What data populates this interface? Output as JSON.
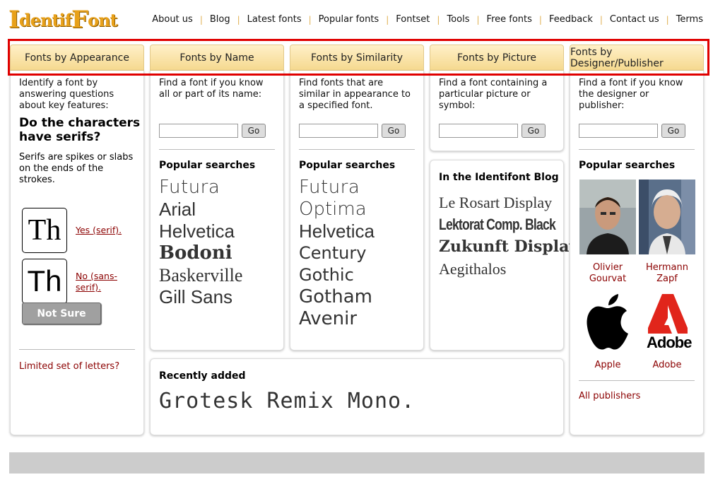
{
  "logo": {
    "part1": "I",
    "part2": "dentif",
    "part3": "ont"
  },
  "topnav": [
    "About us",
    "Blog",
    "Latest fonts",
    "Popular fonts",
    "Fontset",
    "Tools",
    "Free fonts",
    "Feedback",
    "Contact us",
    "Terms"
  ],
  "tabs": [
    "Fonts by Appearance",
    "Fonts by Name",
    "Fonts by Similarity",
    "Fonts by Picture",
    "Fonts by Designer/Publisher"
  ],
  "appearance": {
    "desc": "Identify a font by answering questions about key features:",
    "question": "Do the characters have serifs?",
    "note": "Serifs are spikes or slabs on the ends of the strokes.",
    "sample": "Th",
    "yes_label": "Yes (serif).",
    "no_label": "No (sans-serif).",
    "not_sure": "Not Sure",
    "limited": "Limited set of letters?"
  },
  "name": {
    "desc": "Find a font if you know all or part of its name:",
    "go": "Go",
    "popular_title": "Popular searches",
    "popular": [
      "Futura",
      "Arial",
      "Helvetica",
      "Bodoni",
      "Baskerville",
      "Gill Sans"
    ]
  },
  "similarity": {
    "desc": "Find fonts that are similar in appearance to a specified font.",
    "go": "Go",
    "popular_title": "Popular searches",
    "popular": [
      "Futura",
      "Optima",
      "Helvetica",
      "Century Gothic",
      "Gotham",
      "Avenir"
    ]
  },
  "picture": {
    "desc": "Find a font containing a particular picture or symbol:",
    "go": "Go"
  },
  "blog": {
    "title": "In the Identifont Blog",
    "items": [
      "Le Rosart Display",
      "Lektorat Comp. Black",
      "Zukunft Display",
      "Aegithalos"
    ]
  },
  "recent": {
    "title": "Recently added",
    "font": "Grotesk Remix Mono."
  },
  "designer": {
    "desc": "Find a font if you know the designer or publisher:",
    "go": "Go",
    "popular_title": "Popular searches",
    "people": [
      {
        "name_line1": "Olivier",
        "name_line2": "Gourvat"
      },
      {
        "name_line1": "Hermann",
        "name_line2": "Zapf"
      },
      {
        "name_line1": "Apple",
        "name_line2": ""
      },
      {
        "name_line1": "Adobe",
        "name_line2": ""
      }
    ],
    "adobe_wordmark": "Adobe",
    "all_publishers": "All publishers"
  },
  "colors": {
    "link_red": "#8b0000",
    "tab_bg": "#f5d98f",
    "highlight": "#e00000",
    "logo_orange": "#e8a11a"
  }
}
